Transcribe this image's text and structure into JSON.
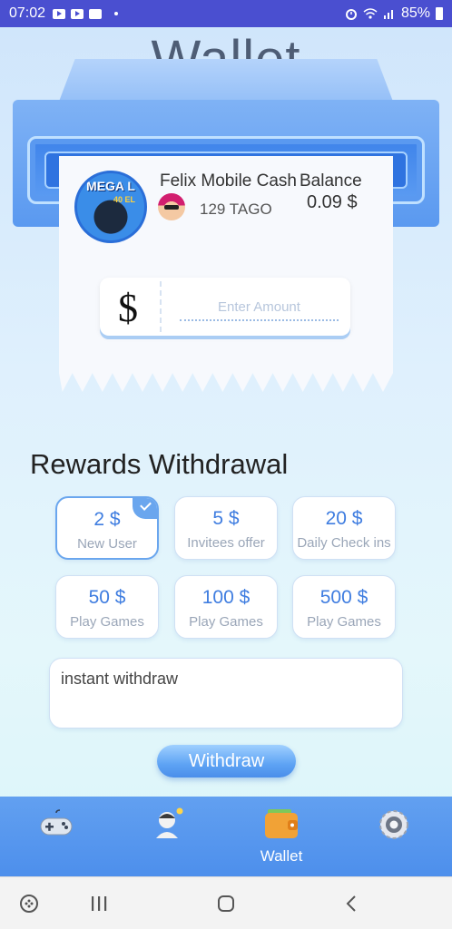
{
  "status_bar": {
    "time": "07:02",
    "battery": "85%",
    "icons": [
      "youtube-icon",
      "youtube-icon",
      "image-icon",
      "alarm-icon",
      "wifi-icon",
      "signal-icon",
      "battery-icon"
    ]
  },
  "page": {
    "title": "Wallet"
  },
  "account": {
    "logo_text": "MEGA L",
    "logo_sub": "40 EL",
    "app_name": "Felix Mobile Cash",
    "points": "129 TAGO",
    "balance_label": "Balance",
    "balance_value": "0.09 $"
  },
  "amount": {
    "currency_symbol": "$",
    "placeholder": "Enter Amount",
    "value": ""
  },
  "rewards": {
    "title": "Rewards Withdrawal",
    "options": [
      {
        "amount": "2 $",
        "label": "New User",
        "selected": true
      },
      {
        "amount": "5 $",
        "label": "Invitees offer",
        "selected": false
      },
      {
        "amount": "20 $",
        "label": "Daily Check ins",
        "selected": false
      },
      {
        "amount": "50 $",
        "label": "Play Games",
        "selected": false
      },
      {
        "amount": "100 $",
        "label": "Play Games",
        "selected": false
      },
      {
        "amount": "500 $",
        "label": "Play Games",
        "selected": false
      }
    ],
    "note": "instant withdraw",
    "withdraw_label": "Withdraw"
  },
  "tabs": [
    {
      "icon": "gamepad-icon",
      "label": ""
    },
    {
      "icon": "user-idea-icon",
      "label": ""
    },
    {
      "icon": "wallet-icon",
      "label": "Wallet",
      "active": true
    },
    {
      "icon": "settings-icon",
      "label": ""
    }
  ],
  "colors": {
    "accent": "#3f7de0",
    "tabbar": "#4d8fec",
    "status_bar": "#4a4fd0"
  }
}
